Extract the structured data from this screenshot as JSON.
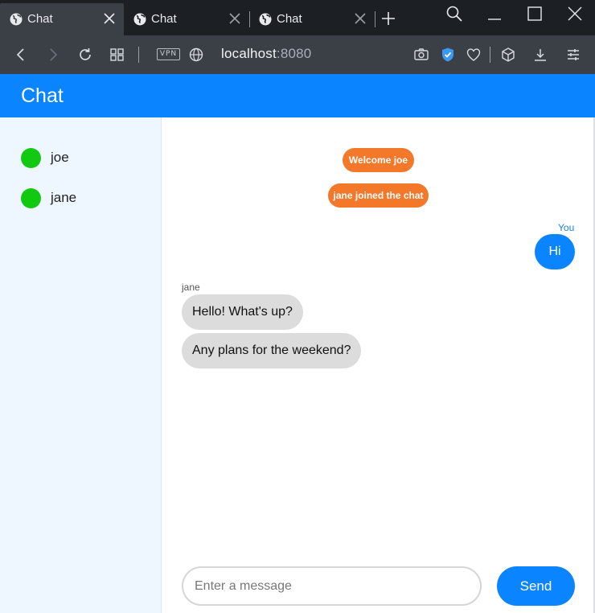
{
  "browser": {
    "tabs": [
      {
        "label": "Chat",
        "active": true
      },
      {
        "label": "Chat",
        "active": false
      },
      {
        "label": "Chat",
        "active": false
      }
    ],
    "vpn_label": "VPN",
    "url_host": "localhost",
    "url_port": ":8080",
    "icons": [
      "search-icon",
      "minimize-icon",
      "maximize-icon",
      "close-icon",
      "back-icon",
      "forward-icon",
      "reload-icon",
      "tabs-grid-icon",
      "globe-icon",
      "camera-icon",
      "shield-icon",
      "heart-icon",
      "cube-icon",
      "download-icon",
      "settings-icon"
    ]
  },
  "app": {
    "title": "Chat",
    "accent_color": "#0a84ff",
    "online_color": "#12c912",
    "system_color": "#f3782a"
  },
  "users": [
    {
      "name": "joe"
    },
    {
      "name": "jane"
    }
  ],
  "messages": {
    "system": [
      "Welcome joe",
      "jane joined the chat"
    ],
    "me_label": "You",
    "me": [
      "Hi"
    ],
    "other_sender": "jane",
    "other": [
      "Hello! What's up?",
      "Any plans for the weekend?"
    ]
  },
  "composer": {
    "placeholder": "Enter a message",
    "value": "",
    "send_label": "Send"
  }
}
